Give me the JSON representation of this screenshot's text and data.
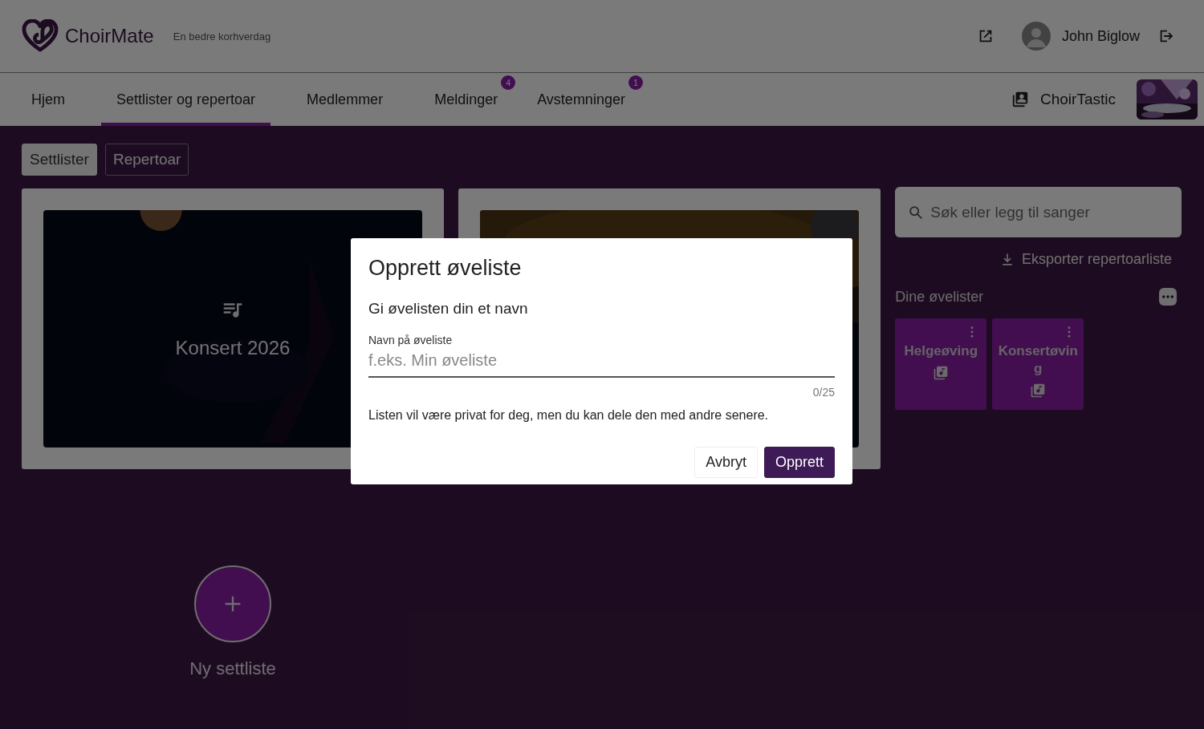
{
  "header": {
    "logo": "ChoirMate",
    "tagline": "En bedre korhverdag",
    "user": {
      "name": "John Biglow"
    }
  },
  "nav": {
    "tabs": [
      {
        "label": "Hjem",
        "selected": false
      },
      {
        "label": "Settlister og repertoar",
        "selected": true
      },
      {
        "label": "Medlemmer",
        "selected": false
      },
      {
        "label": "Meldinger",
        "selected": false,
        "badge": "4"
      },
      {
        "label": "Avstemninger",
        "selected": false,
        "badge": "1"
      }
    ],
    "choir": {
      "name": "ChoirTastic"
    }
  },
  "view_toggle": [
    {
      "label": "Settlister",
      "selected": true
    },
    {
      "label": "Repertoar",
      "selected": false
    }
  ],
  "setlists": [
    {
      "title": "Konsert 2026",
      "kind": "dark"
    },
    {
      "kind": "gold"
    }
  ],
  "new_setlist": {
    "label": "Ny settliste"
  },
  "search": {
    "placeholder": "Søk eller legg til sanger"
  },
  "export": {
    "label": "Eksporter repertoarliste"
  },
  "practice_lists": {
    "title": "Dine øvelister",
    "items": [
      {
        "name": "Helgeøving"
      },
      {
        "name": "Konsertøving"
      }
    ]
  },
  "dialog": {
    "title": "Opprett øveliste",
    "subtitle": "Gi øvelisten din et navn",
    "field_label": "Navn på øveliste",
    "placeholder": "f.eks. Min øveliste",
    "counter": "0/25",
    "note": "Listen vil være privat for deg, men du kan dele den med andre senere.",
    "buttons": [
      {
        "label": "Avbryt",
        "kind": "secondary"
      },
      {
        "label": "Opprett",
        "kind": "primary"
      }
    ]
  }
}
